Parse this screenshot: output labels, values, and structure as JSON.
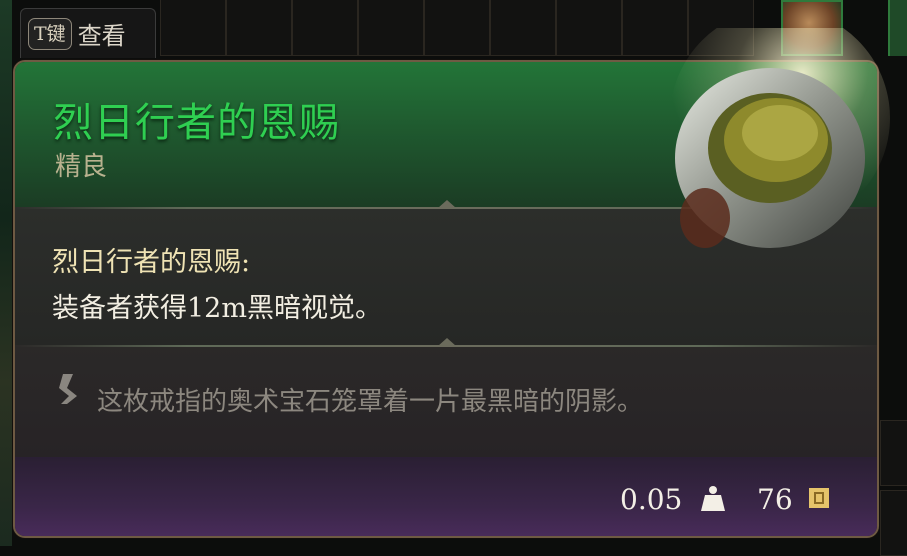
{
  "hint": {
    "key": "T键",
    "label": "查看"
  },
  "item": {
    "name": "烈日行者的恩赐",
    "rarity": "精良",
    "effect_title": "烈日行者的恩赐:",
    "effect_body": "装备者获得12m黑暗视觉。",
    "flavor": "这枚戒指的奥术宝石笼罩着一片最黑暗的阴影。",
    "weight": "0.05",
    "price": "76"
  },
  "icons": {
    "weight": "weight-icon",
    "price": "gold-coin-icon",
    "flavor": "scroll-quote-icon",
    "item": "ring-icon"
  },
  "colors": {
    "rarity_name": "#2fcf51",
    "header_green": "#237538",
    "footer_purple": "#4a2c5c",
    "border": "#6e5a43"
  }
}
